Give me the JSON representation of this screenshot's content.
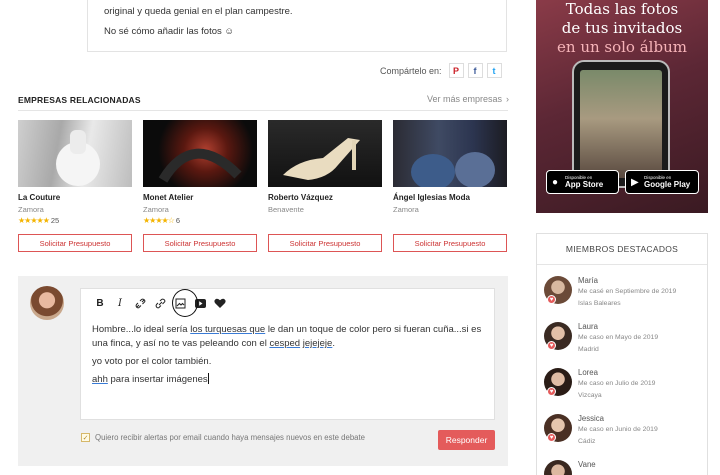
{
  "post": {
    "line1": "original y queda genial en el plan campestre.",
    "line2": "No sé cómo añadir las fotos ☺"
  },
  "share": {
    "label": "Compártelo en:",
    "buttons": [
      "P",
      "f",
      "t"
    ]
  },
  "related": {
    "title": "EMPRESAS RELACIONADAS",
    "more_link": "Ver más empresas",
    "more_icon": "chevron-right-icon",
    "button_label": "Solicitar Presupuesto",
    "vendors": [
      {
        "name": "La Couture",
        "location": "Zamora",
        "stars": "★★★★★",
        "reviews": "25"
      },
      {
        "name": "Monet Atelier",
        "location": "Zamora",
        "stars": "★★★★☆",
        "reviews": "6"
      },
      {
        "name": "Roberto Vázquez",
        "location": "Benavente",
        "stars": "",
        "reviews": ""
      },
      {
        "name": "Ángel Iglesias Moda",
        "location": "Zamora",
        "stars": "",
        "reviews": ""
      }
    ]
  },
  "editor": {
    "toolbar": {
      "bold": "B",
      "italic": "I",
      "icons": [
        "bold-icon",
        "italic-icon",
        "unlink-icon",
        "link-icon",
        "image-icon",
        "video-icon",
        "heart-icon"
      ]
    },
    "para1_a": "Hombre...lo ideal sería ",
    "para1_link1": "los turquesas que",
    "para1_b": " le dan un toque de color pero si fueran cuña...si es una finca, y así no te vas peleando con el ",
    "para1_link2": "cesped",
    "para1_c": " ",
    "para1_link3": "jejejeje",
    "para1_d": ".",
    "para2": "yo voto por el color también.",
    "para3_link": "ahh",
    "para3_rest": " para insertar imágenes",
    "alert_label": "Quiero recibir alertas por email cuando haya mensajes nuevos en este debate",
    "alert_checked": true,
    "reply_button": "Responder"
  },
  "ad": {
    "line1": "Todas las fotos",
    "line2": "de tus invitados",
    "line3": "en un solo álbum",
    "appstore_small": "Disponible en",
    "appstore_big": "App Store",
    "googleplay_small": "Disponible en",
    "googleplay_big": "Google Play"
  },
  "members": {
    "title": "MIEMBROS DESTACADOS",
    "list": [
      {
        "name": "María",
        "date": "Me casé en Septiembre de 2019",
        "place": "Islas Baleares"
      },
      {
        "name": "Laura",
        "date": "Me caso en Mayo de 2019",
        "place": "Madrid"
      },
      {
        "name": "Lorea",
        "date": "Me caso en Julio de 2019",
        "place": "Vizcaya"
      },
      {
        "name": "Jessica",
        "date": "Me caso en Junio de 2019",
        "place": "Cádiz"
      },
      {
        "name": "Vane",
        "date": "",
        "place": ""
      }
    ]
  },
  "colors": {
    "accent": "#e45b5b",
    "star": "#f4b400",
    "link_underline": "#3a7bd5"
  }
}
